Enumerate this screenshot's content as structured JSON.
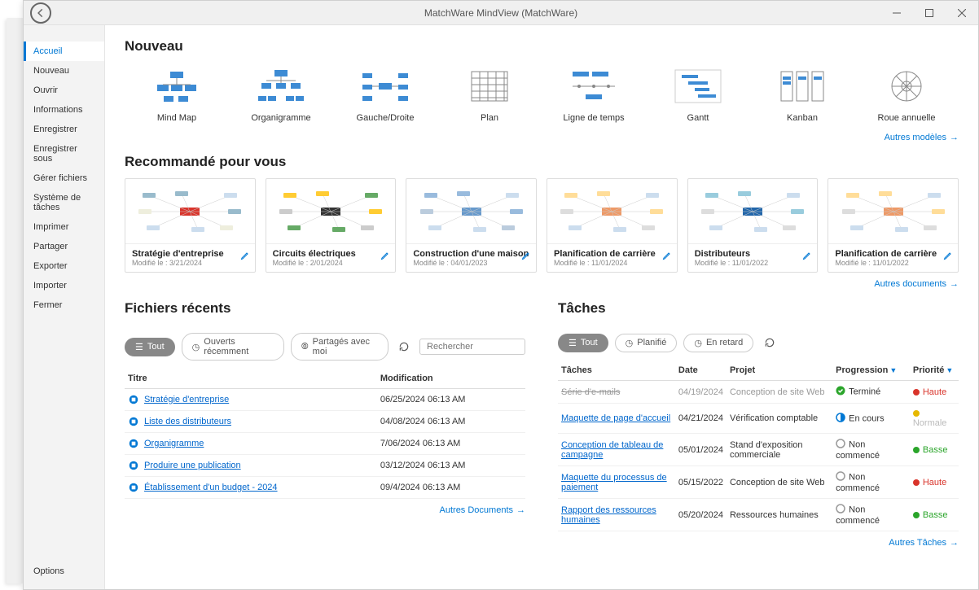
{
  "window": {
    "title": "MatchWare MindView (MatchWare)"
  },
  "sidebar": {
    "items": [
      "Accueil",
      "Nouveau",
      "Ouvrir",
      "Informations",
      "Enregistrer",
      "Enregistrer sous",
      "Gérer fichiers",
      "Système de tâches",
      "Imprimer",
      "Partager",
      "Exporter",
      "Importer",
      "Fermer"
    ],
    "bottom": "Options"
  },
  "sections": {
    "new_title": "Nouveau",
    "other_templates": "Autres modèles",
    "recommended_title": "Recommandé pour vous",
    "other_documents": "Autres documents",
    "recent_title": "Fichiers récents",
    "tasks_title": "Tâches",
    "more_docs": "Autres Documents",
    "more_tasks": "Autres Tâches"
  },
  "templates": [
    {
      "label": "Mind Map"
    },
    {
      "label": "Organigramme"
    },
    {
      "label": "Gauche/Droite"
    },
    {
      "label": "Plan"
    },
    {
      "label": "Ligne de temps"
    },
    {
      "label": "Gantt"
    },
    {
      "label": "Kanban"
    },
    {
      "label": "Roue annuelle"
    }
  ],
  "recommended": [
    {
      "title": "Stratégie d'entreprise",
      "sub": "Modifié le : 3/21/2024"
    },
    {
      "title": "Circuits électriques",
      "sub": "Modifié le : 2/01/2024"
    },
    {
      "title": "Construction d'une maison",
      "sub": "Modifié le : 04/01/2023"
    },
    {
      "title": "Planification de carrière",
      "sub": "Modifié le : 11/01/2024"
    },
    {
      "title": "Distributeurs",
      "sub": "Modifié le : 11/01/2022"
    },
    {
      "title": "Planification de carrière",
      "sub": "Modifié le : 11/01/2022"
    }
  ],
  "recent_filters": {
    "all": "Tout",
    "opened": "Ouverts récemment",
    "shared": "Partagés avec moi",
    "search_placeholder": "Rechercher"
  },
  "recent_headers": {
    "title": "Titre",
    "modified": "Modification"
  },
  "recent_files": [
    {
      "title": "Stratégie d'entreprise",
      "modified": "06/25/2024 06:13 AM"
    },
    {
      "title": "Liste des distributeurs",
      "modified": "04/08/2024 06:13 AM"
    },
    {
      "title": "Organigramme",
      "modified": "7/06/2024 06:13 AM"
    },
    {
      "title": "Produire une publication",
      "modified": "03/12/2024 06:13 AM"
    },
    {
      "title": "Établissement d'un budget - 2024",
      "modified": "09/4/2024 06:13 AM"
    }
  ],
  "task_filters": {
    "all": "Tout",
    "planned": "Planifié",
    "late": "En retard"
  },
  "task_headers": {
    "task": "Tâches",
    "date": "Date",
    "project": "Projet",
    "progress": "Progression",
    "priority": "Priorité"
  },
  "tasks": [
    {
      "task": "Série d'e-mails",
      "date": "04/19/2024",
      "project": "Conception de site Web",
      "status_color": "#2ba52b",
      "status_fill": "#2ba52b",
      "status": "Terminé",
      "prio_color": "#d9342b",
      "priority": "Haute",
      "done": true
    },
    {
      "task": "Maquette de page d'accueil",
      "date": "04/21/2024",
      "project": "Vérification comptable",
      "status_color": "#0078d4",
      "status_fill": "half",
      "status": "En cours",
      "prio_color": "#e6b800",
      "priority": "Normale",
      "done": false,
      "prio_muted": true
    },
    {
      "task": "Conception de tableau de campagne",
      "date": "05/01/2024",
      "project": "Stand d'exposition commerciale",
      "status_color": "#999",
      "status_fill": "none",
      "status": "Non commencé",
      "prio_color": "#2ba52b",
      "priority": "Basse",
      "done": false
    },
    {
      "task": "Maquette du processus de paiement",
      "date": "05/15/2022",
      "project": "Conception de site Web",
      "status_color": "#999",
      "status_fill": "none",
      "status": "Non commencé",
      "prio_color": "#d9342b",
      "priority": "Haute",
      "done": false
    },
    {
      "task": "Rapport des ressources humaines",
      "date": "05/20/2024",
      "project": "Ressources humaines",
      "status_color": "#999",
      "status_fill": "none",
      "status": "Non commencé",
      "prio_color": "#2ba52b",
      "priority": "Basse",
      "done": false
    }
  ]
}
